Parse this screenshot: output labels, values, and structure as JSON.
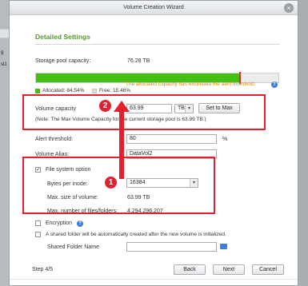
{
  "background": {
    "left_edge_texts": [
      "g",
      "sl1"
    ]
  },
  "dialog": {
    "title": "Volume Creation Wizard",
    "close_glyph": "×",
    "section_title": "Detailed Settings",
    "storage_pool": {
      "label": "Storage pool capacity:",
      "value": "76.28 TB",
      "allocated_fraction": 0.8454,
      "requested_fraction": 0.8384,
      "allocated_legend": "Allocated: 84.54%",
      "free_legend": "Free: 15.46%",
      "warning": "The allocated capacity has exceeded the alert threshold.",
      "colors": {
        "allocated": "#43c012",
        "free": "#ececec",
        "marker": "#d9302a",
        "warning": "#e08a00"
      }
    },
    "volume_capacity": {
      "label": "Volume capacity",
      "value": "63.99",
      "unit": "TB",
      "set_max_button": "Set to Max",
      "note": "(Note: The Max Volume Capacity for the current storage pool is 63.99 TB.)"
    },
    "alert_threshold": {
      "label": "Alert threshold:",
      "value": "80",
      "unit": "%"
    },
    "volume_alias": {
      "label": "Volume Alias:",
      "value": "DataVol2"
    },
    "file_system": {
      "checkbox_label": "File system option",
      "checked": true,
      "bytes_per_inode_label": "Bytes per inode:",
      "bytes_per_inode_value": "16384",
      "max_size_label": "Max. size of volume:",
      "max_size_value": "63.99 TB",
      "max_files_label": "Max. number of files/folders:",
      "max_files_value": "4,294,296,207"
    },
    "encryption": {
      "label": "Encryption",
      "checked": false
    },
    "shared_folder": {
      "label": "A shared folder will be automatically created after the new volume is initialized.",
      "checked": false,
      "name_label": "Shared Folder Name",
      "name_value": ""
    },
    "footer": {
      "step": "Step 4/5",
      "back": "Back",
      "next": "Next",
      "cancel": "Cancel"
    }
  },
  "annotations": {
    "marker_1": "1",
    "marker_2": "2",
    "color": "#e3202b"
  },
  "icons": {
    "help": "help-icon",
    "folder": "folder-icon",
    "close": "close-icon",
    "dropdown": "chevron-down-icon"
  }
}
